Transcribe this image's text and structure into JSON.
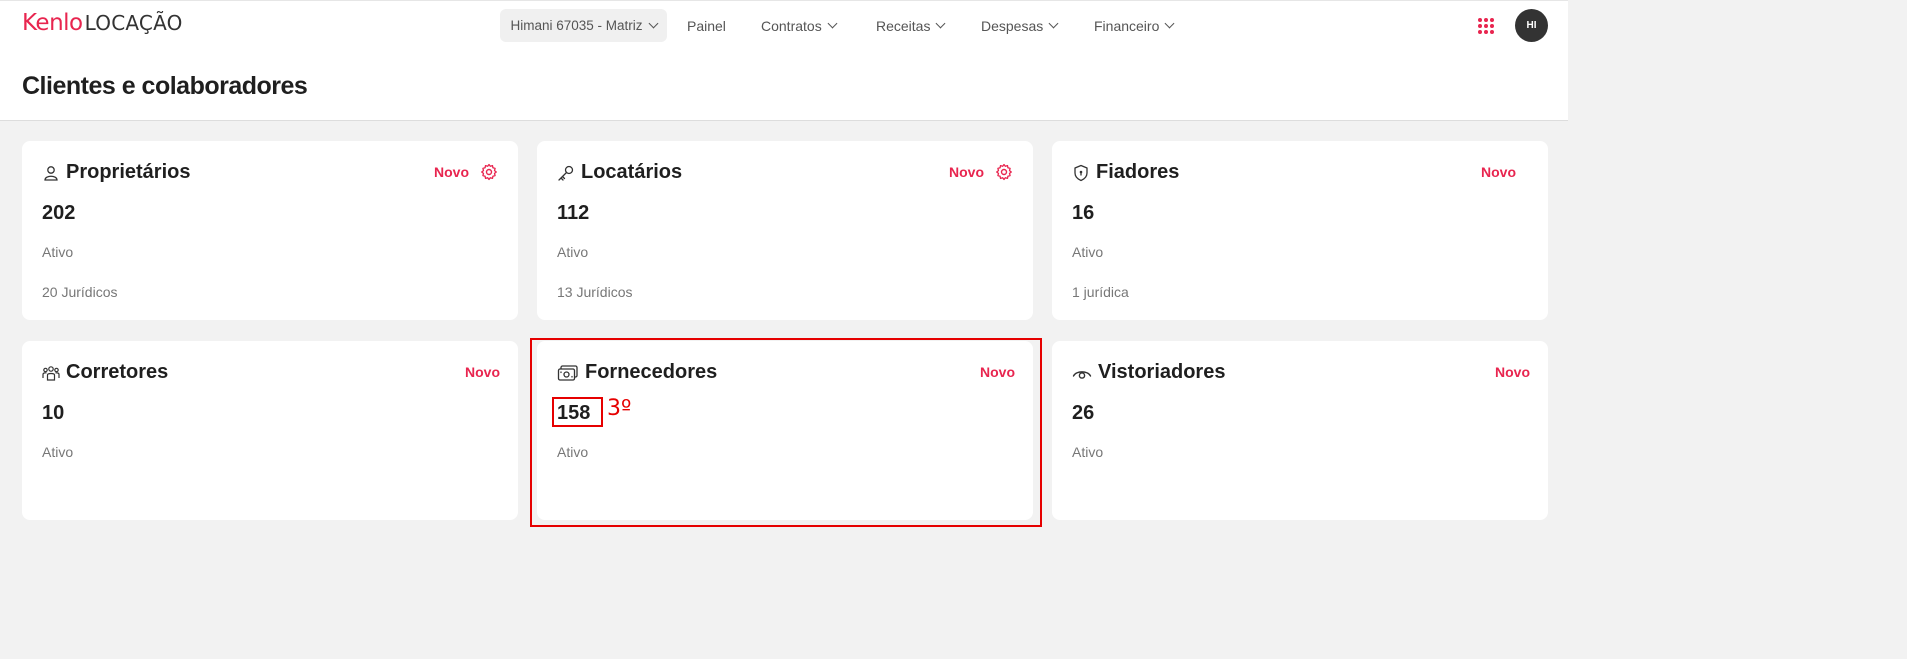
{
  "app": {
    "brand": "Kenlo",
    "product": "LOCAÇÃO"
  },
  "topbar": {
    "account": "Himani 67035 - Matriz",
    "nav": [
      "Painel",
      "Contratos",
      "Receitas",
      "Despesas",
      "Financeiro"
    ],
    "avatar_initials": "HI"
  },
  "page": {
    "title": "Clientes e colaboradores"
  },
  "cards": [
    {
      "title": "Proprietários",
      "icon": "user-icon",
      "action": "Novo",
      "count": "202",
      "status": "Ativo",
      "extra": "20 Jurídicos",
      "has_settings": true
    },
    {
      "title": "Locatários",
      "icon": "key-icon",
      "action": "Novo",
      "count": "112",
      "status": "Ativo",
      "extra": "13 Jurídicos",
      "has_settings": true
    },
    {
      "title": "Fiadores",
      "icon": "shield-icon",
      "action": "Novo",
      "count": "16",
      "status": "Ativo",
      "extra": "1 jurídica",
      "has_settings": false
    },
    {
      "title": "Corretores",
      "icon": "team-icon",
      "action": "Novo",
      "count": "10",
      "status": "Ativo",
      "extra": "",
      "has_settings": false
    },
    {
      "title": "Fornecedores",
      "icon": "money-icon",
      "action": "Novo",
      "count": "158",
      "status": "Ativo",
      "extra": "",
      "has_settings": false
    },
    {
      "title": "Vistoriadores",
      "icon": "eye-icon",
      "action": "Novo",
      "count": "26",
      "status": "Ativo",
      "extra": "",
      "has_settings": false
    }
  ],
  "annotation": {
    "label": "3º"
  },
  "colors": {
    "accent": "#e8254f",
    "highlight": "#e60000",
    "background": "#f2f2f2"
  }
}
